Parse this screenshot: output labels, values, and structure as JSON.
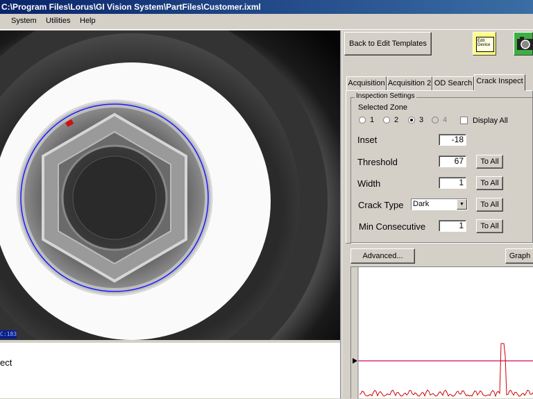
{
  "window": {
    "title": "C:\\Program Files\\Lorus\\GI Vision System\\PartFiles\\Customer.ixml"
  },
  "menu": {
    "items": [
      "System",
      "Utilities",
      "Help"
    ]
  },
  "camera": {
    "label": "C:183"
  },
  "status": {
    "text": "ect"
  },
  "toolbar": {
    "back_button": "Back to Edit Templates",
    "edit_device_label": "Edit Device",
    "camera_icon": "camera-icon"
  },
  "tabs": [
    {
      "label": "Acquisition"
    },
    {
      "label": "Acquisition 2"
    },
    {
      "label": "OD Search"
    },
    {
      "label": "Crack Inspect"
    }
  ],
  "inspection": {
    "group_title": "Inspection Settings",
    "zone_label": "Selected Zone",
    "zones": [
      "1",
      "2",
      "3",
      "4"
    ],
    "selected_zone": "3",
    "display_all_label": "Display All",
    "inset_label": "Inset",
    "inset_value": "-18",
    "threshold_label": "Threshold",
    "threshold_value": "67",
    "width_label": "Width",
    "width_value": "1",
    "crack_type_label": "Crack Type",
    "crack_type_value": "Dark",
    "min_consecutive_label": "Min Consecutive",
    "min_consecutive_value": "1",
    "to_all_label": "To All"
  },
  "actions": {
    "advanced_button": "Advanced...",
    "graph_button": "Graph"
  },
  "colors": {
    "graph_line": "#e0307a",
    "graph_signal": "#cc0000",
    "inspect_circle": "#1a1aff"
  }
}
